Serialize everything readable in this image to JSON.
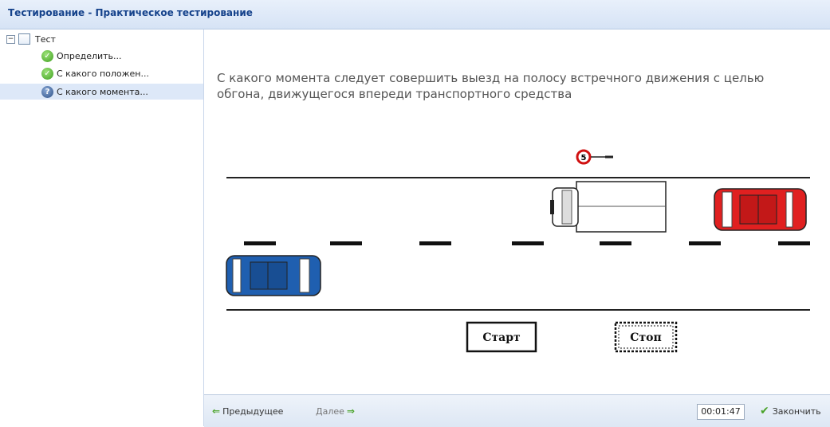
{
  "window": {
    "title": "Тестирование - Практическое тестирование"
  },
  "tree": {
    "root_label": "Тест",
    "items": [
      {
        "label": "Определить...",
        "status": "answered",
        "icon": "check-icon"
      },
      {
        "label": "С какого положен...",
        "status": "answered",
        "icon": "check-icon"
      },
      {
        "label": "С какого момента...",
        "status": "current",
        "icon": "question-icon"
      }
    ]
  },
  "question": {
    "text": "С какого момента следует совершить выезд на полосу встречного движения с целью обгона, движущегося впереди транспортного средства",
    "scene": {
      "sign": {
        "type": "speed-limit-sign",
        "value": "5"
      },
      "markers": {
        "start": "Старт",
        "stop": "Стоп"
      },
      "vehicles": [
        {
          "name": "truck",
          "color": "#ffffff"
        },
        {
          "name": "red-car",
          "color": "#e02020"
        },
        {
          "name": "blue-car",
          "color": "#1f5fb0"
        }
      ]
    }
  },
  "footer": {
    "prev_label": "Предыдущее",
    "next_label": "Далее",
    "timer": "00:01:47",
    "finish_label": "Закончить"
  },
  "colors": {
    "accent": "#15428b",
    "selected": "#dde8f8",
    "ok": "#4aa32a"
  }
}
